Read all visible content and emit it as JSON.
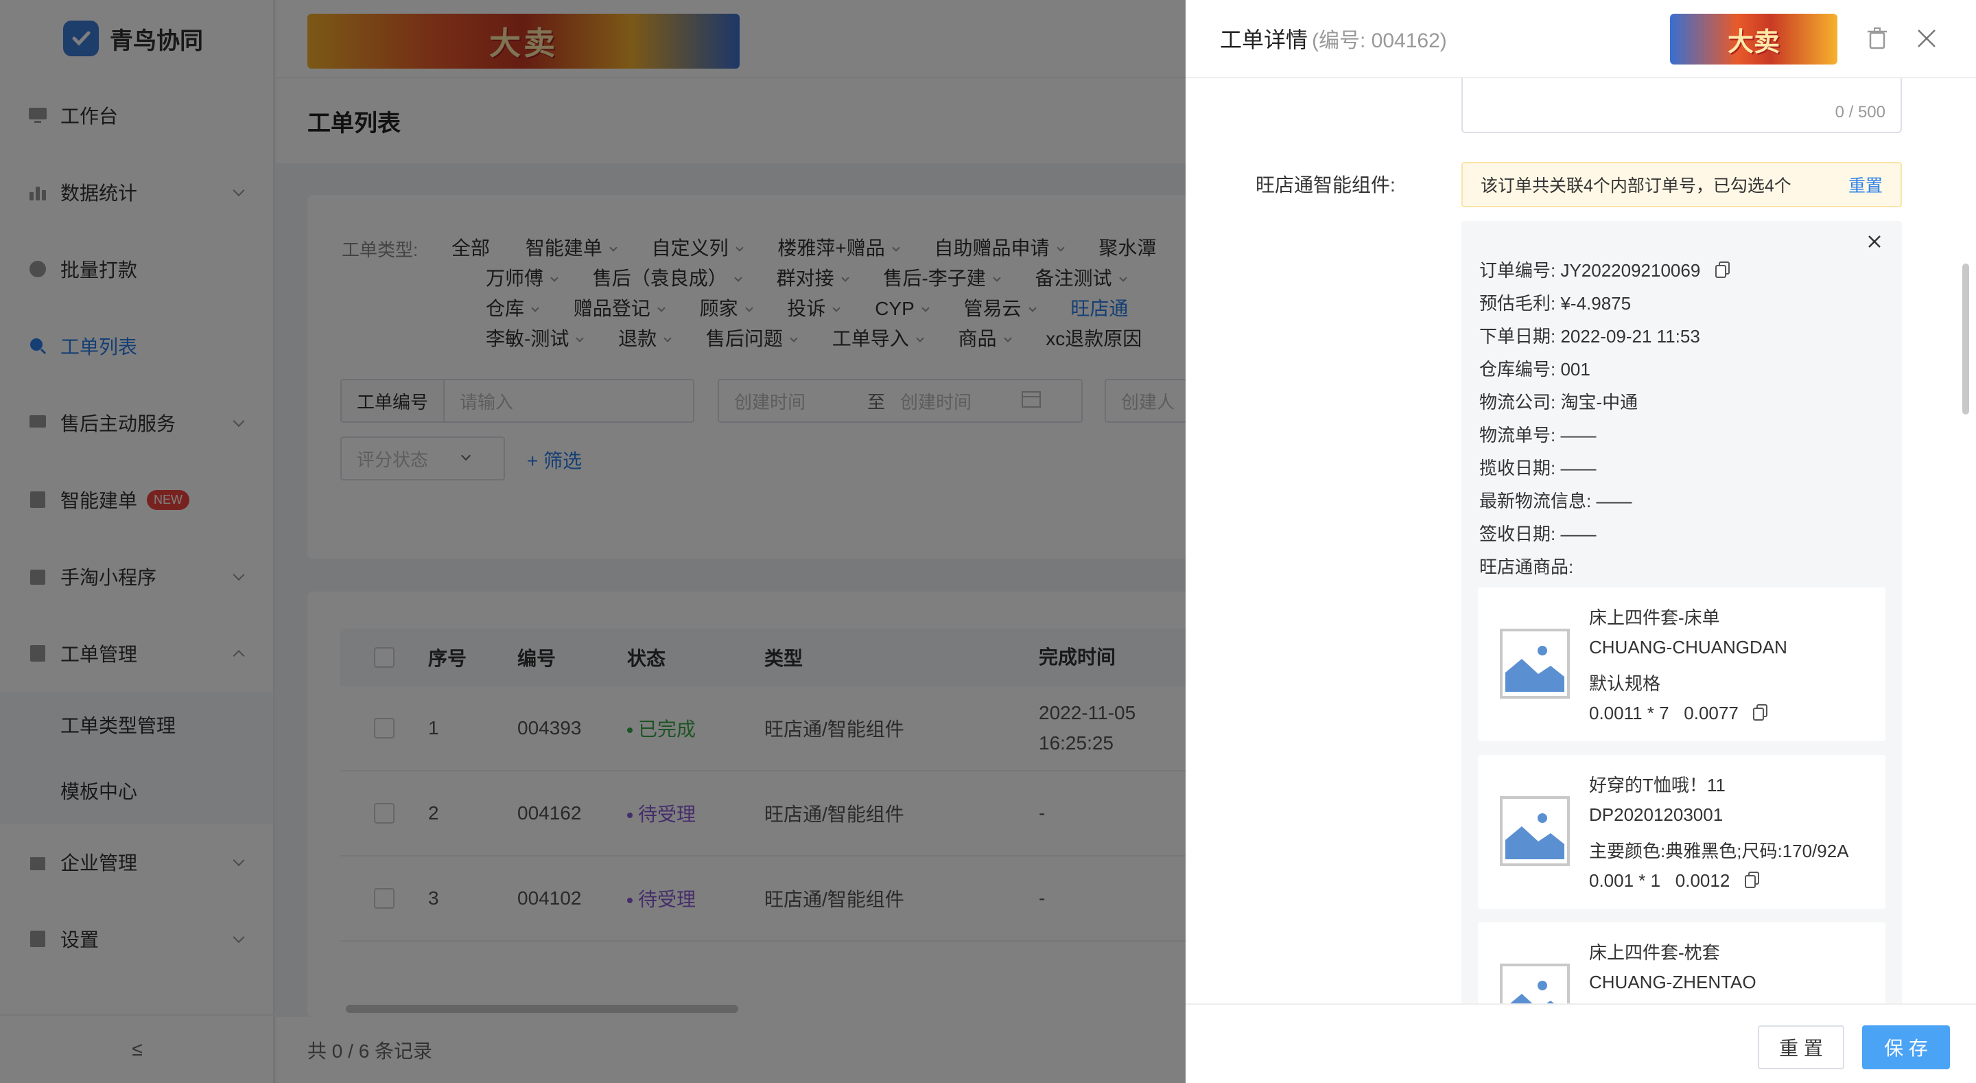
{
  "app": {
    "name": "青鸟协同"
  },
  "banner": {
    "text": "大卖"
  },
  "sidebar": {
    "items": [
      {
        "label": "工作台"
      },
      {
        "label": "数据统计"
      },
      {
        "label": "批量打款"
      },
      {
        "label": "工单列表"
      },
      {
        "label": "售后主动服务"
      },
      {
        "label": "智能建单",
        "badge": "NEW"
      },
      {
        "label": "手淘小程序"
      },
      {
        "label": "工单管理"
      },
      {
        "label": "工单类型管理"
      },
      {
        "label": "模板中心"
      },
      {
        "label": "企业管理"
      },
      {
        "label": "设置"
      }
    ],
    "collapse_icon": "≤"
  },
  "page": {
    "title": "工单列表"
  },
  "filters": {
    "type_label": "工单类型:",
    "rows": [
      [
        "全部",
        "智能建单",
        "自定义列",
        "楼雅萍+赠品",
        "自助赠品申请",
        "聚水潭"
      ],
      [
        "万师傅",
        "售后（袁良成）",
        "群对接",
        "售后-李子建",
        "备注测试"
      ],
      [
        "仓库",
        "赠品登记",
        "顾家",
        "投诉",
        "CYP",
        "管易云",
        "旺店通"
      ],
      [
        "李敏-测试",
        "退款",
        "售后问题",
        "工单导入",
        "商品",
        "xc退款原因"
      ]
    ],
    "ticket_no_label": "工单编号",
    "ticket_no_placeholder": "请输入",
    "created_start_placeholder": "创建时间",
    "range_sep": "至",
    "created_end_placeholder": "创建时间",
    "creator_placeholder": "创建人",
    "rating_placeholder": "评分状态",
    "add_filter": "+ 筛选"
  },
  "table": {
    "headers": [
      "序号",
      "编号",
      "状态",
      "类型",
      "完成时间"
    ],
    "rows": [
      {
        "seq": "1",
        "no": "004393",
        "status": "已完成",
        "type": "旺店通/智能组件",
        "done_date": "2022-11-05",
        "done_time": "16:25:25"
      },
      {
        "seq": "2",
        "no": "004162",
        "status": "待受理",
        "type": "旺店通/智能组件",
        "done_date": "-",
        "done_time": ""
      },
      {
        "seq": "3",
        "no": "004102",
        "status": "待受理",
        "type": "旺店通/智能组件",
        "done_date": "-",
        "done_time": ""
      }
    ]
  },
  "footer": {
    "records": "共 0 / 6 条记录"
  },
  "drawer": {
    "title": "工单详情",
    "subtitle": "(编号: 004162)",
    "counter": "0 / 500",
    "component_label": "旺店通智能组件:",
    "notice": "该订单共关联4个内部订单号，已勾选4个",
    "notice_reset": "重置",
    "order": {
      "order_no": "订单编号: JY202209210069",
      "gross": "预估毛利: ¥-4.9875",
      "date": "下单日期: 2022-09-21 11:53",
      "warehouse": "仓库编号: 001",
      "logistics_company": "物流公司: 淘宝-中通",
      "logistics_no": "物流单号: ——",
      "pickup_date": "揽收日期: ——",
      "latest_info": "最新物流信息: ——",
      "sign_date": "签收日期: ——",
      "goods_label": "旺店通商品:"
    },
    "products": [
      {
        "name": "床上四件套-床单",
        "code": "CHUANG-CHUANGDAN",
        "spec": "默认规格",
        "price": "0.0011 * 7   0.0077"
      },
      {
        "name": "好穿的T恤哦！11",
        "code": "DP20201203001",
        "spec": "主要颜色:典雅黑色;尺码:170/92A",
        "price": "0.001 * 1   0.0012"
      },
      {
        "name": "床上四件套-枕套",
        "code": "CHUANG-ZHENTAO",
        "spec": "",
        "price": ""
      }
    ],
    "btn_reset": "重 置",
    "btn_save": "保 存"
  },
  "colors": {
    "accent": "#2a7ee8",
    "done": "#3aa84a",
    "pending": "#8a5bd6",
    "save": "#4aa3f5"
  }
}
